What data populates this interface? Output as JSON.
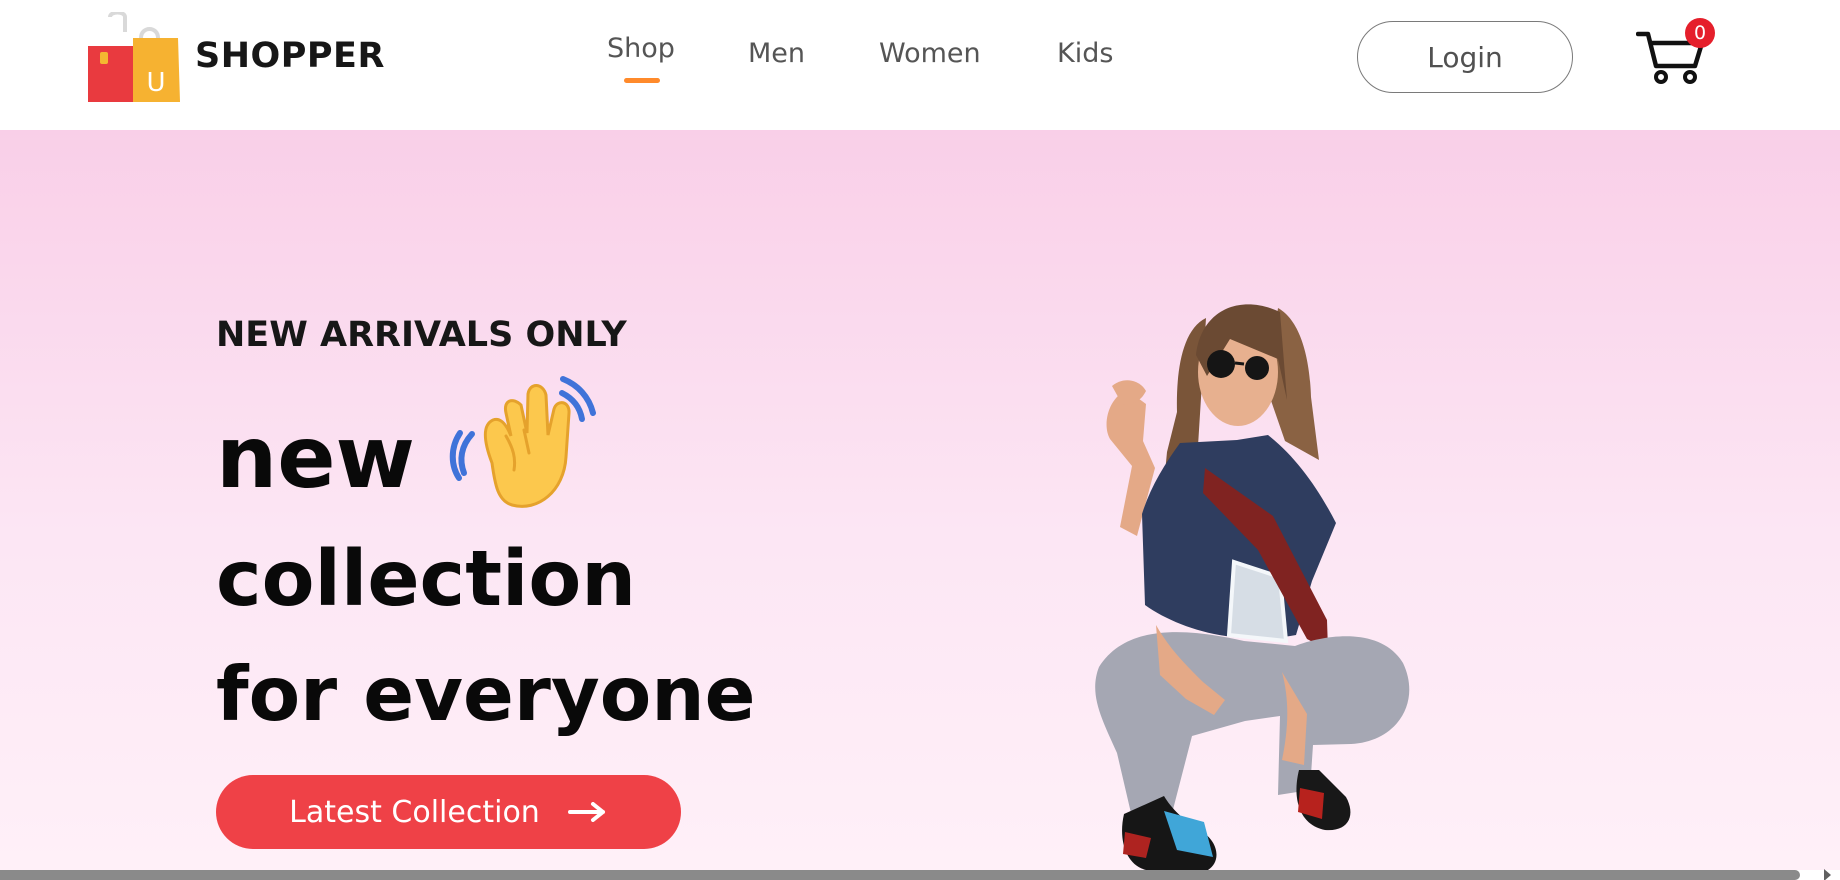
{
  "brand": {
    "name": "SHOPPER",
    "logo_icon": "shopping-bags-icon",
    "logo_letter": "U"
  },
  "nav": {
    "items": [
      {
        "label": "Shop",
        "active": true
      },
      {
        "label": "Men",
        "active": false
      },
      {
        "label": "Women",
        "active": false
      },
      {
        "label": "Kids",
        "active": false
      }
    ]
  },
  "header": {
    "login_label": "Login",
    "cart_icon": "cart-icon",
    "cart_count": "0"
  },
  "hero": {
    "eyebrow": "NEW ARRIVALS ONLY",
    "headline_lines": [
      "new",
      "collection",
      "for everyone"
    ],
    "hand_icon": "waving-hand-icon",
    "cta_label": "Latest Collection",
    "cta_icon": "arrow-right-icon",
    "image_icon": "fashion-model-image"
  },
  "colors": {
    "accent": "#ef4147",
    "active_underline": "#ff8a2b",
    "badge": "#e51f2b",
    "hero_background_top": "#f9cfe8",
    "hero_background_bottom": "#fff0f8"
  }
}
